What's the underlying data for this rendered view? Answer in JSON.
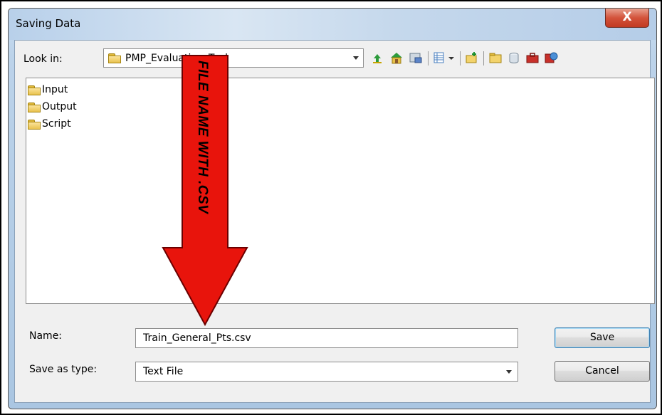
{
  "dialog": {
    "title": "Saving Data",
    "close_label": "X"
  },
  "look_in": {
    "label": "Look in:",
    "value": "PMP_Evaluation_Tool"
  },
  "toolbar": {
    "icons": [
      "up-one-level-icon",
      "home-icon",
      "connect-folder-icon",
      "view-menu-icon",
      "new-folder-icon",
      "folder-icon",
      "database-icon",
      "toolbox-icon",
      "globe-icon"
    ]
  },
  "files": [
    {
      "name": "Input",
      "icon": "folder-icon"
    },
    {
      "name": "Output",
      "icon": "folder-icon"
    },
    {
      "name": "Script",
      "icon": "folder-icon"
    }
  ],
  "name_field": {
    "label": "Name:",
    "value": "Train_General_Pts.csv"
  },
  "type_field": {
    "label": "Save as type:",
    "value": "Text File"
  },
  "buttons": {
    "save": "Save",
    "cancel": "Cancel"
  },
  "annotation": {
    "text": "FILE NAME WITH .CSV",
    "color": "#e8140c"
  }
}
